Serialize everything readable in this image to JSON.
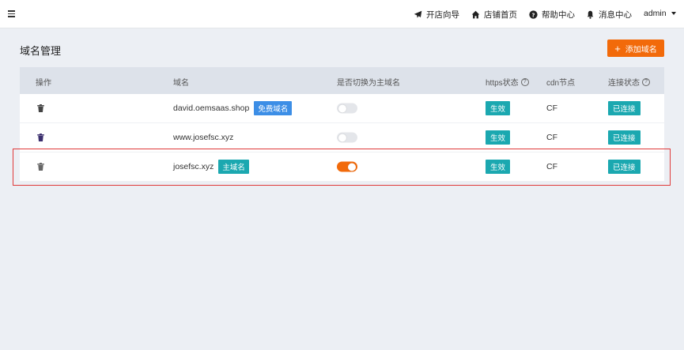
{
  "header": {
    "nav": {
      "guide": "开店向导",
      "home": "店铺首页",
      "help": "帮助中心",
      "messages": "消息中心",
      "user": "admin"
    }
  },
  "page": {
    "title": "域名管理",
    "add_button": "添加域名"
  },
  "table": {
    "columns": {
      "action": "操作",
      "domain": "域名",
      "primary_switch": "是否切换为主域名",
      "https": "https状态",
      "cdn": "cdn节点",
      "connection": "连接状态"
    },
    "rows": [
      {
        "domain": "david.oemsaas.shop",
        "tag": "免费域名",
        "primary": false,
        "https": "生效",
        "cdn": "CF",
        "connection": "已连接"
      },
      {
        "domain": "www.josefsc.xyz",
        "tag": "",
        "primary": false,
        "https": "生效",
        "cdn": "CF",
        "connection": "已连接"
      },
      {
        "domain": "josefsc.xyz",
        "tag": "主域名",
        "primary": true,
        "https": "生效",
        "cdn": "CF",
        "connection": "已连接"
      }
    ]
  },
  "colors": {
    "accent": "#f26a0a",
    "tag_blue": "#3c8ee6",
    "status_teal": "#1ba8b0",
    "highlight": "#e03a3a"
  }
}
